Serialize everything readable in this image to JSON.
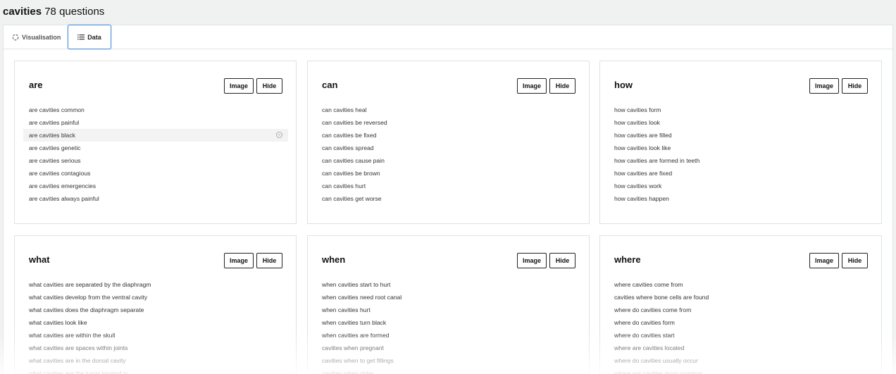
{
  "header": {
    "term": "cavities",
    "count_text": "78 questions"
  },
  "tabs": [
    {
      "label": "Visualisation",
      "icon": "spinner-icon",
      "active": false
    },
    {
      "label": "Data",
      "icon": "list-icon",
      "active": true
    }
  ],
  "buttons": {
    "image_label": "Image",
    "hide_label": "Hide"
  },
  "cards": [
    {
      "heading": "are",
      "items": [
        "are cavities common",
        "are cavities painful",
        "are cavities black",
        "are cavities genetic",
        "are cavities serious",
        "are cavities contagious",
        "are cavities emergencies",
        "are cavities always painful"
      ]
    },
    {
      "heading": "can",
      "items": [
        "can cavities heal",
        "can cavities be reversed",
        "can cavities be fixed",
        "can cavities spread",
        "can cavities cause pain",
        "can cavities be brown",
        "can cavities hurt",
        "can cavities get worse"
      ]
    },
    {
      "heading": "how",
      "items": [
        "how cavities form",
        "how cavities look",
        "how cavities are filled",
        "how cavities look like",
        "how cavities are formed in teeth",
        "how cavities are fixed",
        "how cavities work",
        "how cavities happen"
      ]
    },
    {
      "heading": "what",
      "items": [
        "what cavities are separated by the diaphragm",
        "what cavities develop from the ventral cavity",
        "what cavities does the diaphragm separate",
        "what cavities look like",
        "what cavities are within the skull",
        "what cavities are spaces within joints",
        "what cavities are in the dorsal cavity",
        "what cavities are the lungs located in"
      ]
    },
    {
      "heading": "when",
      "items": [
        "when cavities start to hurt",
        "when cavities need root canal",
        "when cavities hurt",
        "when cavities turn black",
        "when cavities are formed",
        "cavities when pregnant",
        "cavities when to get fillings",
        "cavities when older"
      ]
    },
    {
      "heading": "where",
      "items": [
        "where cavities come from",
        "cavities where bone cells are found",
        "where do cavities come from",
        "where do cavities form",
        "where do cavities start",
        "where are cavities located",
        "where do cavities usually occur",
        "where are cavities most common"
      ]
    }
  ]
}
